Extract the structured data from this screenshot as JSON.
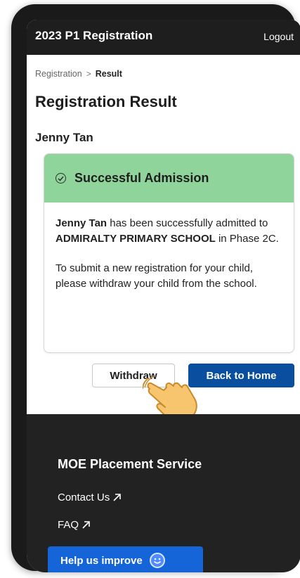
{
  "header": {
    "title": "2023 P1 Registration",
    "logout_label": "Logout"
  },
  "breadcrumb": {
    "parent": "Registration",
    "separator": ">",
    "current": "Result"
  },
  "page": {
    "title": "Registration Result",
    "child_name": "Jenny Tan"
  },
  "result_card": {
    "status_icon": "check-circle-icon",
    "status_text": "Successful Admission",
    "status_color": "#8fd49b",
    "message": {
      "name": "Jenny Tan",
      "text1": " has been successfully admitted to ",
      "school": "ADMIRALTY PRIMARY SCHOOL",
      "text2": " in Phase 2C."
    },
    "note": "To submit a new registration for your child, please withdraw your child from the school."
  },
  "actions": {
    "withdraw_label": "Withdraw",
    "home_label": "Back to Home",
    "home_color": "#0a4ea0"
  },
  "footer": {
    "title": "MOE Placement Service",
    "links": [
      {
        "label": "Contact Us",
        "icon": "external-arrow-icon"
      },
      {
        "label": "FAQ",
        "icon": "external-arrow-icon"
      }
    ],
    "help_label": "Help us improve",
    "help_icon": "smiley-icon",
    "help_color": "#1565d8"
  }
}
